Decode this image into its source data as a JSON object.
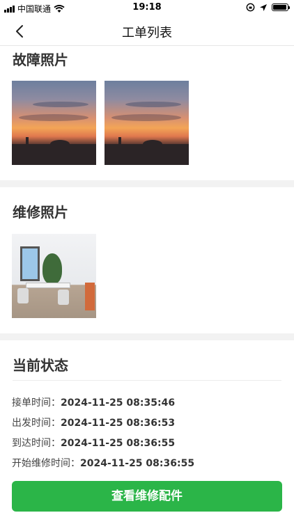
{
  "status_bar": {
    "carrier": "中国联通",
    "time": "19:18",
    "battery_level": 0.95
  },
  "nav": {
    "title": "工单列表",
    "back_icon": "chevron-left-icon"
  },
  "fault_photos": {
    "title": "故障照片",
    "count": 2
  },
  "repair_photos": {
    "title": "维修照片",
    "count": 1
  },
  "current_status": {
    "title": "当前状态",
    "rows": [
      {
        "label": "接单时间：",
        "value": "2024-11-25 08:35:46"
      },
      {
        "label": "出发时间：",
        "value": "2024-11-25 08:36:53"
      },
      {
        "label": "到达时间：",
        "value": "2024-11-25 08:36:55"
      },
      {
        "label": "开始维修时间：",
        "value": "2024-11-25 08:36:55"
      }
    ]
  },
  "footer": {
    "button_label": "查看维修配件"
  },
  "colors": {
    "primary": "#2bb548",
    "background": "#f2f2f2"
  }
}
